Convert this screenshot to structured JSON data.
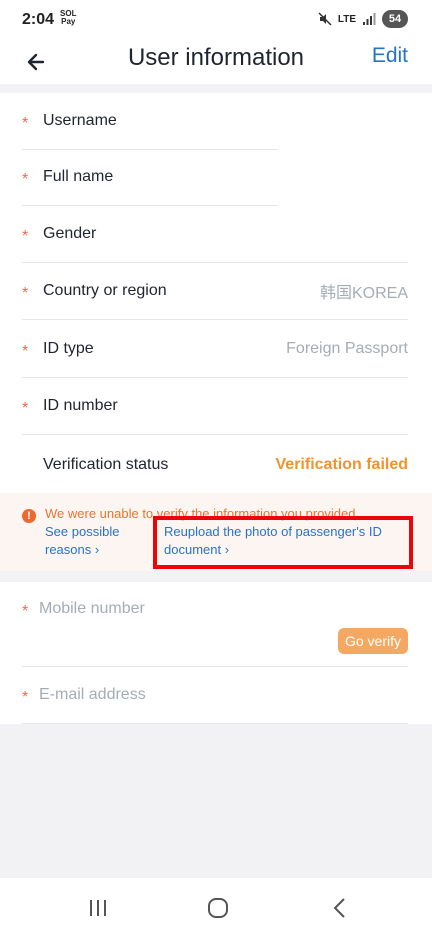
{
  "status_bar": {
    "time": "2:04",
    "pay_top": "SOL",
    "pay_bottom": "Pay",
    "network": "LTE",
    "battery": "54"
  },
  "header": {
    "title": "User information",
    "edit": "Edit"
  },
  "fields": {
    "username": "Username",
    "full_name": "Full name",
    "gender": "Gender",
    "country": {
      "label": "Country or region",
      "value": "韩国KOREA"
    },
    "id_type": {
      "label": "ID type",
      "value": "Foreign Passport"
    },
    "id_number": "ID number",
    "verification": {
      "label": "Verification status",
      "value": "Verification failed"
    }
  },
  "notice": {
    "message": "We were unable to verify the information you provided",
    "reasons_line1": "See possible",
    "reasons_line2": "reasons ›",
    "reupload_line1": "Reupload the photo of passenger's ID",
    "reupload_line2": "document ›"
  },
  "contact": {
    "mobile": "Mobile number",
    "go_verify": "Go verify",
    "email": "E-mail address"
  },
  "required_mark": "*",
  "colors": {
    "accent": "#2673c9",
    "warning": "#f0932f",
    "required": "#ec6a4f",
    "highlight": "#e8060a"
  }
}
